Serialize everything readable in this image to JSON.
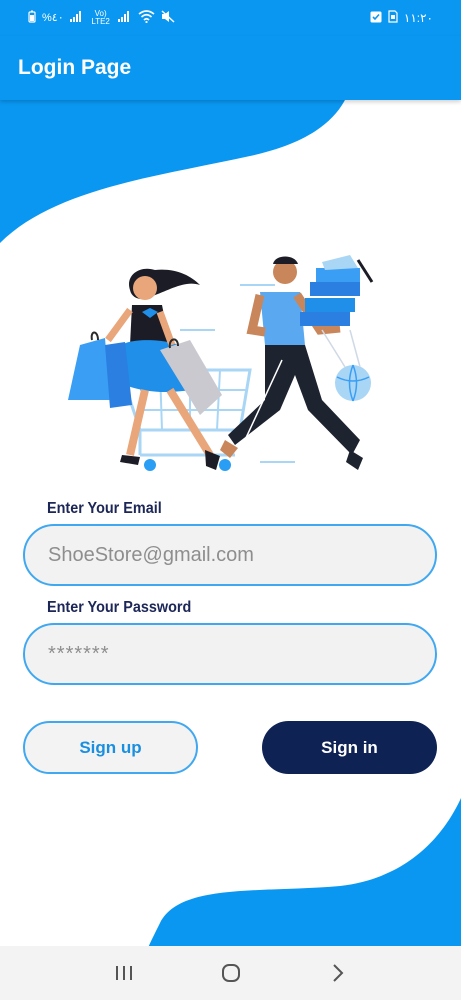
{
  "status_bar": {
    "left_text": "%٤٠",
    "network_label": "Vo) LTE2",
    "time": "١١:٢٠"
  },
  "app_bar": {
    "title": "Login Page"
  },
  "form": {
    "email_label": "Enter Your Email",
    "email_value": "ShoeStore@gmail.com",
    "password_label": "Enter Your Password",
    "password_value": "*******"
  },
  "buttons": {
    "signup_label": "Sign up",
    "signin_label": "Sign in"
  },
  "colors": {
    "primary": "#0a97f2",
    "dark_navy": "#0e2254",
    "field_border": "#40a8f0",
    "field_bg": "#f2f2f2"
  },
  "icons": {
    "status": [
      "battery-icon",
      "signal-icon",
      "wifi-icon",
      "mute-icon",
      "checkbox-icon",
      "sim-icon"
    ],
    "nav": [
      "recent-apps-icon",
      "home-icon",
      "back-icon"
    ]
  }
}
